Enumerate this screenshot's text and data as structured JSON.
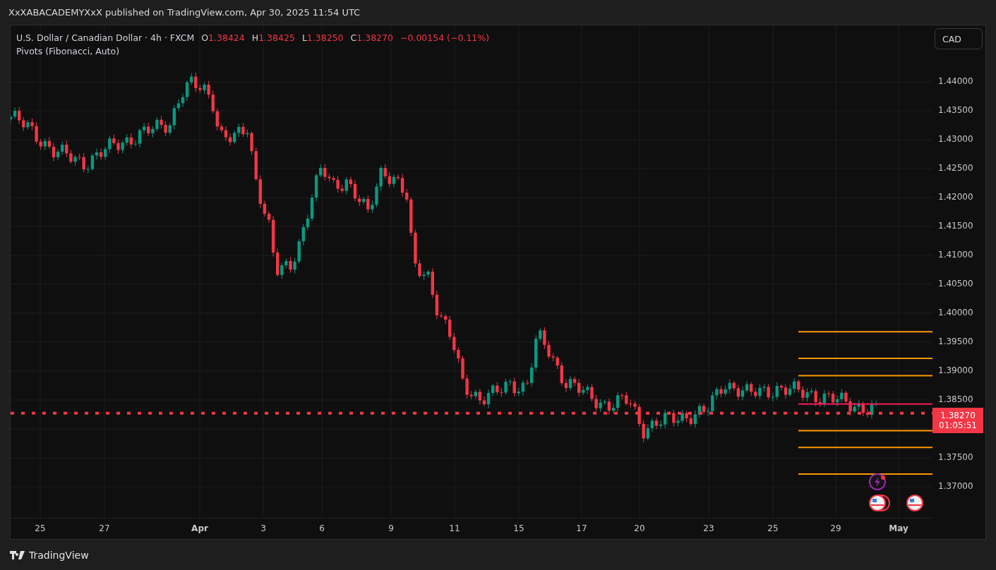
{
  "header": {
    "publisher": "XxXABACADEMYXxX published on TradingView.com, Apr 30, 2025 11:54 UTC"
  },
  "legend": {
    "symbol": "U.S. Dollar / Canadian Dollar · 4h · FXCM",
    "ohlc": [
      {
        "key": "O",
        "value": "1.38424"
      },
      {
        "key": "H",
        "value": "1.38425"
      },
      {
        "key": "L",
        "value": "1.38250"
      },
      {
        "key": "C",
        "value": "1.38270"
      }
    ],
    "change": "−0.00154 (−0.11%)",
    "indicator": "Pivots (Fibonacci, Auto)"
  },
  "price_axis": {
    "currency": "CAD",
    "ticks": [
      "1.44000",
      "1.43500",
      "1.43000",
      "1.42500",
      "1.42000",
      "1.41500",
      "1.41000",
      "1.40500",
      "1.40000",
      "1.39500",
      "1.39000",
      "1.38500",
      "1.37500",
      "1.37000"
    ],
    "last_price": "1.38270",
    "countdown": "01:05:51"
  },
  "time_axis": [
    {
      "label": "25",
      "kind": "day"
    },
    {
      "label": "27",
      "kind": "day"
    },
    {
      "label": "Apr",
      "kind": "month"
    },
    {
      "label": "3",
      "kind": "day"
    },
    {
      "label": "6",
      "kind": "day"
    },
    {
      "label": "9",
      "kind": "day"
    },
    {
      "label": "11",
      "kind": "day"
    },
    {
      "label": "15",
      "kind": "day"
    },
    {
      "label": "17",
      "kind": "day"
    },
    {
      "label": "20",
      "kind": "day"
    },
    {
      "label": "23",
      "kind": "day"
    },
    {
      "label": "25",
      "kind": "day"
    },
    {
      "label": "29",
      "kind": "day"
    },
    {
      "label": "May",
      "kind": "month"
    }
  ],
  "footer": {
    "brand": "TradingView"
  }
}
